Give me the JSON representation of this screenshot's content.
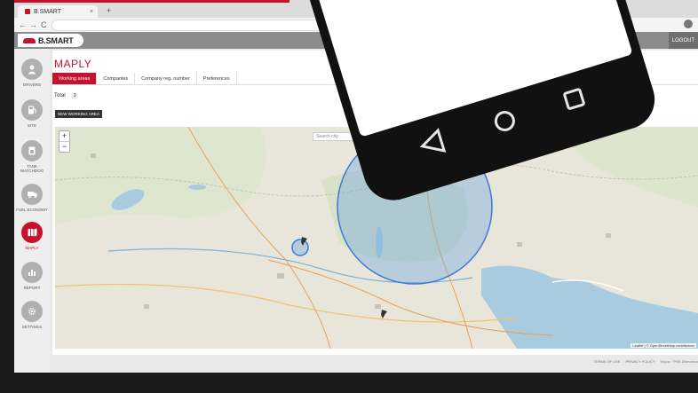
{
  "browser": {
    "tab_title": "B.SMART",
    "new_tab": "+",
    "back": "←",
    "forward": "→",
    "reload": "C"
  },
  "header": {
    "logo_text": "B.SMART",
    "logout": "LOGOUT"
  },
  "sidebar": {
    "items": [
      {
        "label": "DRIVERS",
        "icon": "driver-icon"
      },
      {
        "label": "SITE",
        "icon": "fuel-pump-icon"
      },
      {
        "label": "TANK WATCHDOG",
        "icon": "tank-icon"
      },
      {
        "label": "FUEL ECONOMY",
        "icon": "truck-icon"
      },
      {
        "label": "MAPLY",
        "icon": "map-icon"
      },
      {
        "label": "REPORT",
        "icon": "bar-chart-icon"
      },
      {
        "label": "SETTINGS",
        "icon": "gear-icon"
      }
    ]
  },
  "page": {
    "title": "MAPLY",
    "tabs": [
      "Working areas",
      "Companies",
      "Company reg. number",
      "Preferences"
    ],
    "total_label": "Total",
    "total_count": "3",
    "new_area_button": "NEW WORKING AREA"
  },
  "map": {
    "search_placeholder": "Search city",
    "zoom_in": "+",
    "zoom_out": "−",
    "attribution": "Leaflet | © OpenStreetMap contributors"
  },
  "footer": {
    "terms": "TERMS OF USE",
    "privacy": "PRIVACY POLICY",
    "version": "Vuyuo · PVB 3/hrn.ecco"
  },
  "colors": {
    "accent": "#c4122f",
    "header_grey": "#8c8c8c",
    "area_fill": "#6fa8dc",
    "area_stroke": "#3c78d8"
  }
}
